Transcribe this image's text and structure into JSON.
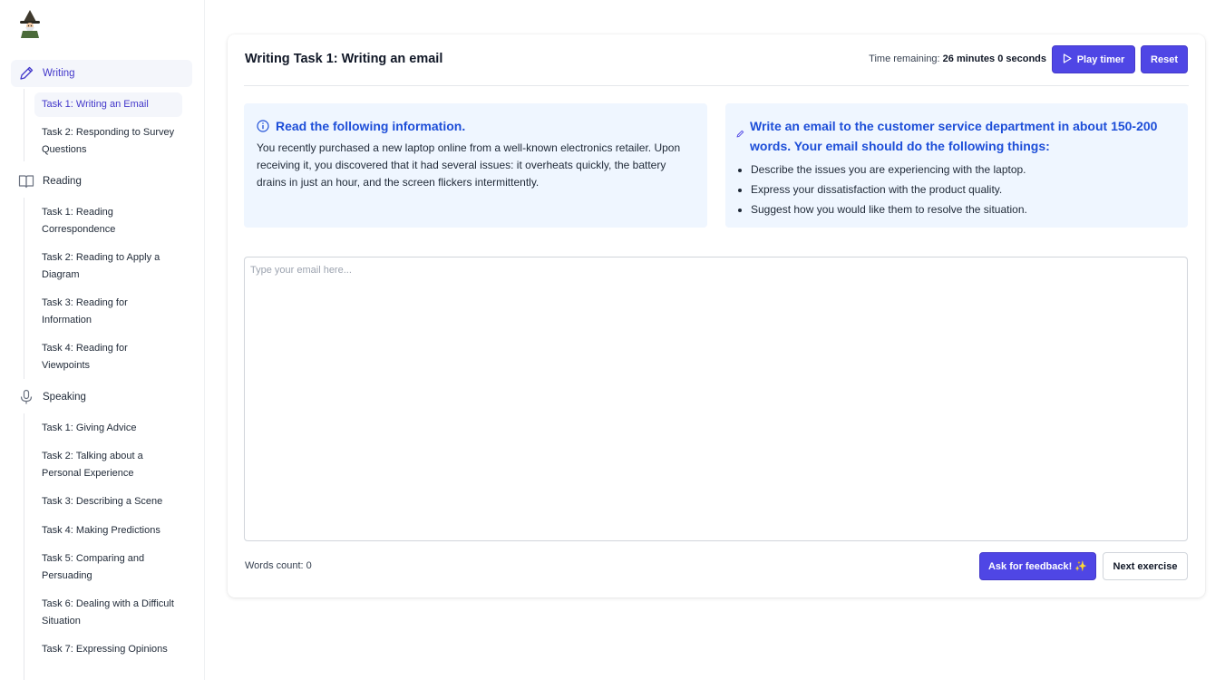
{
  "sidebar": {
    "sections": [
      {
        "label": "Writing",
        "icon": "pencil-icon",
        "items": [
          "Task 1: Writing an Email",
          "Task 2: Responding to Survey Questions"
        ]
      },
      {
        "label": "Reading",
        "icon": "book-icon",
        "items": [
          "Task 1: Reading Correspondence",
          "Task 2: Reading to Apply a Diagram",
          "Task 3: Reading for Information",
          "Task 4: Reading for Viewpoints"
        ]
      },
      {
        "label": "Speaking",
        "icon": "microphone-icon",
        "items": [
          "Task 1: Giving Advice",
          "Task 2: Talking about a Personal Experience",
          "Task 3: Describing a Scene",
          "Task 4: Making Predictions",
          "Task 5: Comparing and Persuading",
          "Task 6: Dealing with a Difficult Situation",
          "Task 7: Expressing Opinions"
        ]
      }
    ]
  },
  "header": {
    "title": "Writing Task 1: Writing an email",
    "timer_label": "Time remaining:",
    "timer_value": "26 minutes 0 seconds",
    "play_label": "Play timer",
    "reset_label": "Reset"
  },
  "info_box": {
    "heading": "Read the following information.",
    "body": "You recently purchased a new laptop online from a well-known electronics retailer. Upon receiving it, you discovered that it had several issues: it overheats quickly, the battery drains in just an hour, and the screen flickers intermittently."
  },
  "task_box": {
    "heading": "Write an email to the customer service department in about 150-200 words. Your email should do the following things:",
    "bullets": [
      "Describe the issues you are experiencing with the laptop.",
      "Express your dissatisfaction with the product quality.",
      "Suggest how you would like them to resolve the situation."
    ]
  },
  "editor": {
    "placeholder": "Type your email here...",
    "value": ""
  },
  "footer": {
    "words_label": "Words count: 0",
    "feedback_label": "Ask for feedback! ✨",
    "next_label": "Next exercise"
  },
  "colors": {
    "accent": "#4f46e5",
    "info_bg": "#eff6ff",
    "heading_blue": "#1d4ed8",
    "active_text": "#4338ca"
  }
}
